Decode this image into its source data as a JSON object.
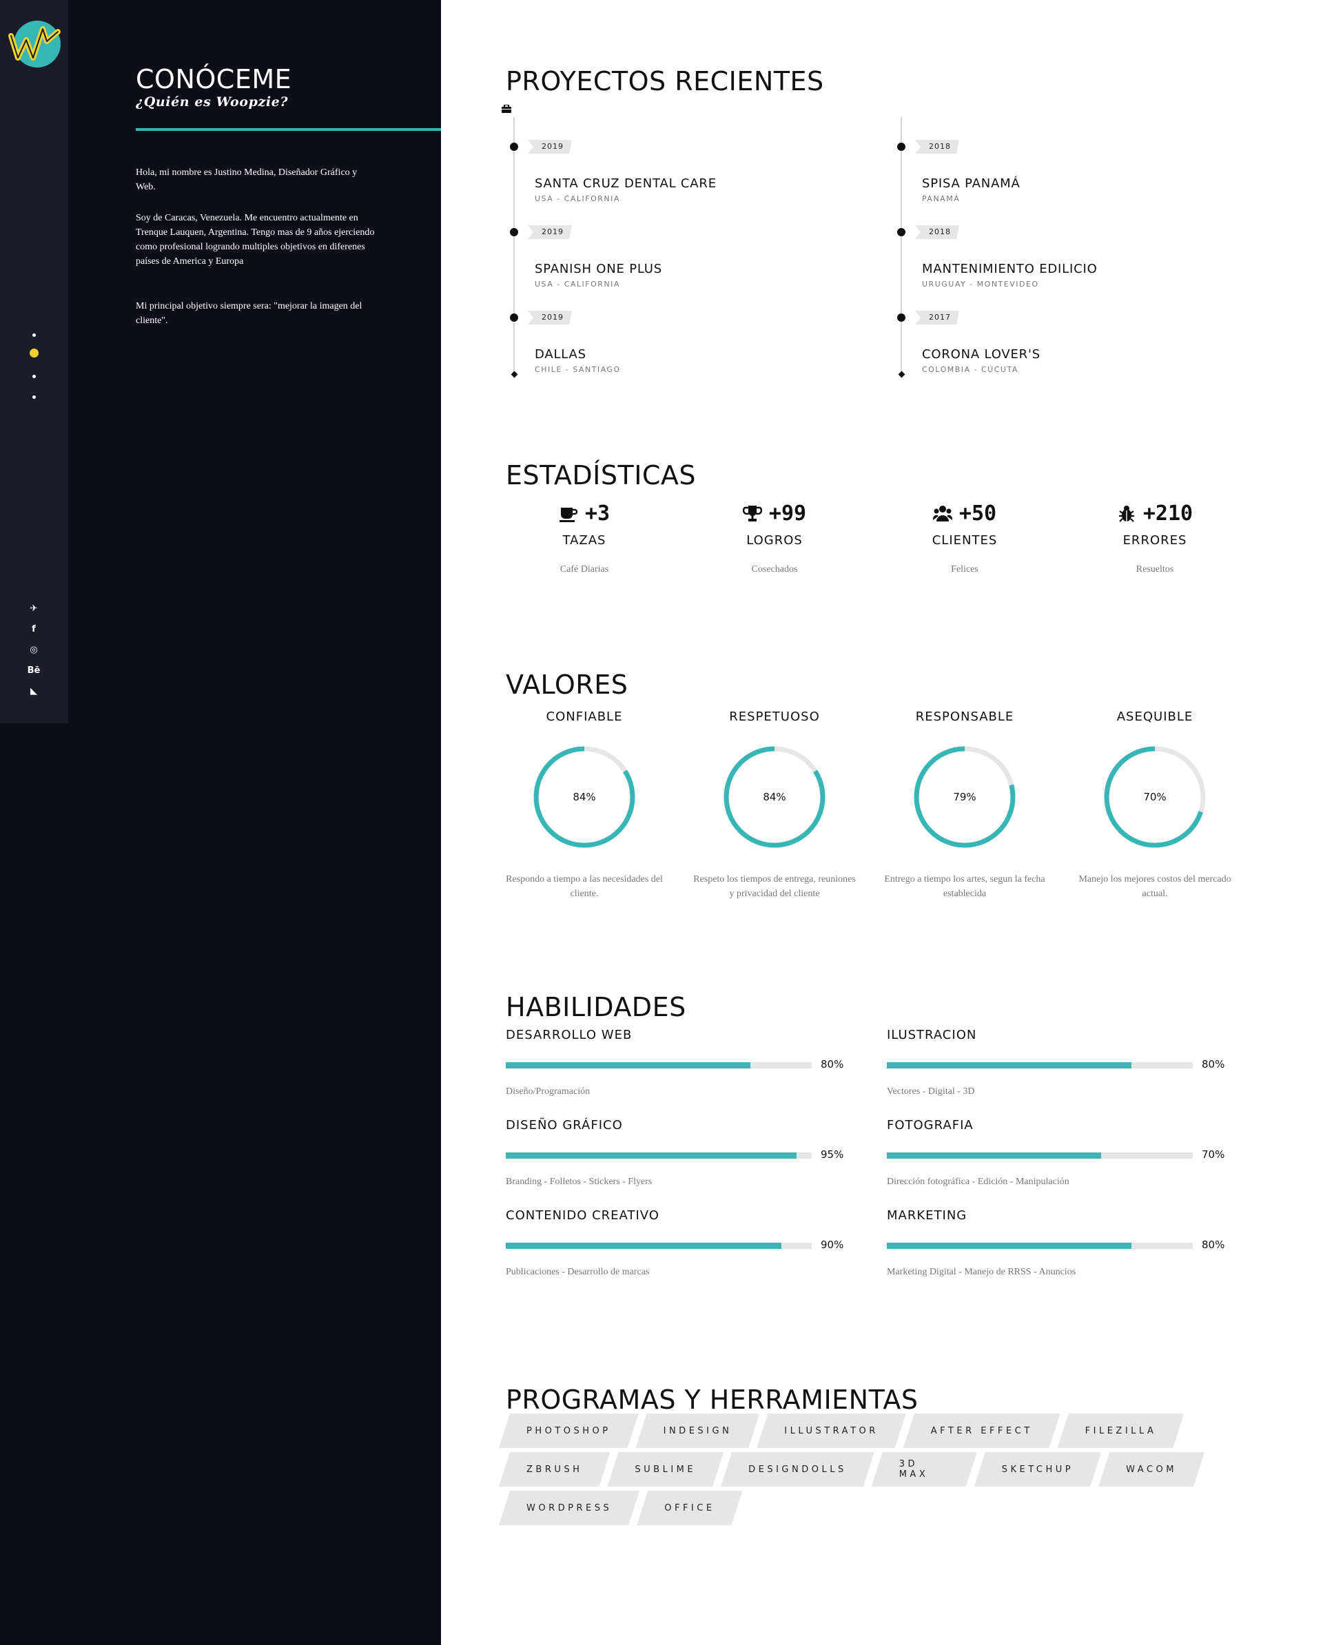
{
  "nav": {
    "logo": "woopzie-logo-icon",
    "dots": [
      {
        "active": false
      },
      {
        "active": true
      },
      {
        "active": false
      },
      {
        "active": false
      }
    ],
    "social": [
      {
        "icon": "telegram-icon",
        "glyph": "✈"
      },
      {
        "icon": "facebook-icon",
        "glyph": "f"
      },
      {
        "icon": "instagram-icon",
        "glyph": "◎"
      },
      {
        "icon": "behance-icon",
        "glyph": "Bē"
      },
      {
        "icon": "rss-icon",
        "glyph": "◣"
      }
    ]
  },
  "about": {
    "title": "CONÓCEME",
    "subtitle": "¿Quién es Woopzie?",
    "paragraphs": [
      "Hola, mi nombre es Justino Medina, Diseñador Gráfico y Web.",
      "Soy de Caracas, Venezuela. Me encuentro actualmente en Trenque Lauquen, Argentina. Tengo mas de 9 años ejerciendo como profesional logrando multiples objetivos en diferenes países de America y Europa",
      "Mi principal objetivo siempre sera: \"mejorar la imagen del cliente\"."
    ]
  },
  "projects": {
    "title": "PROYECTOS RECIENTES",
    "icon": "briefcase-icon",
    "left": [
      {
        "year": "2019",
        "name": "SANTA CRUZ DENTAL CARE",
        "location": "USA - CALIFORNIA"
      },
      {
        "year": "2019",
        "name": "SPANISH ONE PLUS",
        "location": "USA - CALIFORNIA"
      },
      {
        "year": "2019",
        "name": "DALLAS",
        "location": "CHILE - SANTIAGO"
      }
    ],
    "right": [
      {
        "year": "2018",
        "name": "SPISA PANAMÁ",
        "location": "PANAMÁ"
      },
      {
        "year": "2018",
        "name": "MANTENIMIENTO EDILICIO",
        "location": "URUGUAY - MONTEVIDEO"
      },
      {
        "year": "2017",
        "name": "CORONA LOVER'S",
        "location": "COLOMBIA - CÚCUTA"
      }
    ]
  },
  "stats": {
    "title": "ESTADÍSTICAS",
    "items": [
      {
        "icon": "coffee-icon",
        "value": "+3",
        "label": "TAZAS",
        "sub": "Café Diarias"
      },
      {
        "icon": "trophy-icon",
        "value": "+99",
        "label": "LOGROS",
        "sub": "Cosechados"
      },
      {
        "icon": "users-icon",
        "value": "+50",
        "label": "CLIENTES",
        "sub": "Felices"
      },
      {
        "icon": "bug-icon",
        "value": "+210",
        "label": "ERRORES",
        "sub": "Resueltos"
      }
    ]
  },
  "values": {
    "title": "VALORES",
    "ring_color": "#38b6b6",
    "track_color": "#e6e6e6",
    "items": [
      {
        "label": "CONFIABLE",
        "percent": 84,
        "percent_text": "84%",
        "desc": "Respondo a tiempo a las necesidades del cliente."
      },
      {
        "label": "RESPETUOSO",
        "percent": 84,
        "percent_text": "84%",
        "desc": "Respeto los tiempos de entrega, reuniones y privacidad del cliente"
      },
      {
        "label": "RESPONSABLE",
        "percent": 79,
        "percent_text": "79%",
        "desc": "Entrego a tiempo los artes, segun la fecha establecida"
      },
      {
        "label": "ASEQUIBLE",
        "percent": 70,
        "percent_text": "70%",
        "desc": "Manejo los mejores costos del mercado actual."
      }
    ]
  },
  "skills": {
    "title": "HABILIDADES",
    "items": [
      {
        "name": "DESARROLLO WEB",
        "percent": 80,
        "percent_text": "80%",
        "sub": "Diseño/Programación"
      },
      {
        "name": "ILUSTRACION",
        "percent": 80,
        "percent_text": "80%",
        "sub": "Vectores - Digital - 3D"
      },
      {
        "name": "DISEÑO GRÁFICO",
        "percent": 95,
        "percent_text": "95%",
        "sub": "Branding - Folletos - Stickers - Flyers"
      },
      {
        "name": "FOTOGRAFIA",
        "percent": 70,
        "percent_text": "70%",
        "sub": "Dirección fotográfica - Edición - Manipulación"
      },
      {
        "name": "CONTENIDO CREATIVO",
        "percent": 90,
        "percent_text": "90%",
        "sub": "Publicaciones - Desarrollo de marcas"
      },
      {
        "name": "MARKETING",
        "percent": 80,
        "percent_text": "80%",
        "sub": "Marketing Digital - Manejo de RRSS - Anuncios"
      }
    ]
  },
  "tools": {
    "title": "PROGRAMAS Y HERRAMIENTAS",
    "rows": [
      [
        "PHOTOSHOP",
        "INDESIGN",
        "ILLUSTRATOR",
        "AFTER EFFECT",
        "FILEZILLA"
      ],
      [
        "ZBRUSH",
        "SUBLIME",
        "DESIGNDOLLS",
        "3D MAX",
        "SKETCHUP",
        "WACOM"
      ],
      [
        "WORDPRESS",
        "OFFICE"
      ]
    ]
  },
  "colors": {
    "accent": "#38b6b6",
    "active_dot": "#f2d22c",
    "dark_bg": "#0e0f16",
    "nav_bg": "#1b1c28"
  }
}
